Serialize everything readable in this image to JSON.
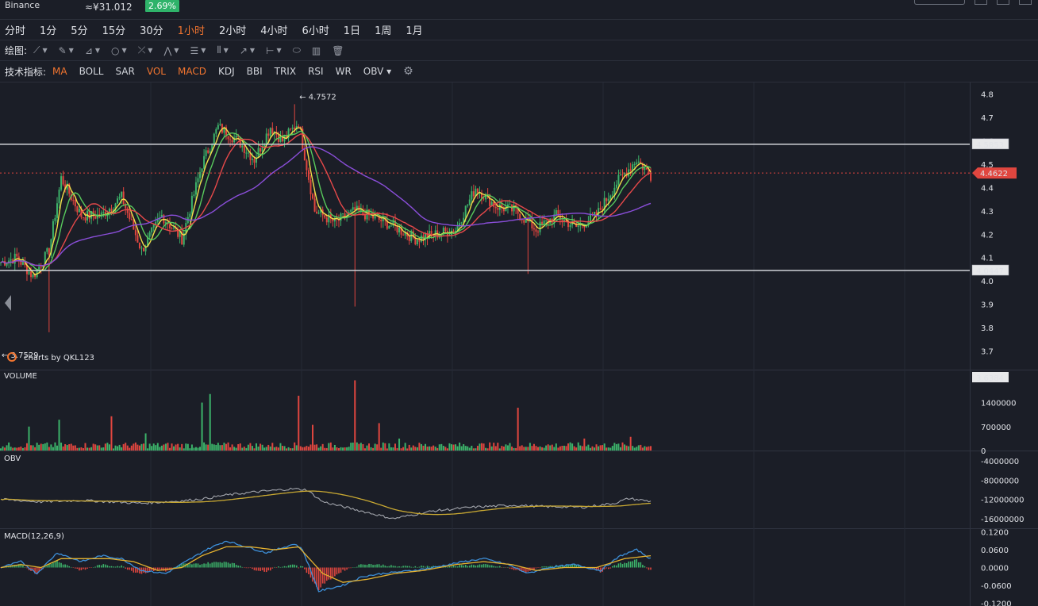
{
  "header": {
    "exchange": "Binance",
    "cny_price": "≈¥31.012",
    "change_pct": "2.69%"
  },
  "intervals": [
    "分时",
    "1分",
    "5分",
    "15分",
    "30分",
    "1小时",
    "2小时",
    "4小时",
    "6小时",
    "1日",
    "1周",
    "1月"
  ],
  "active_interval": "1小时",
  "drawing": {
    "label": "绘图:",
    "tools": [
      "trend-line-icon",
      "pen-icon",
      "channel-icon",
      "circle-icon",
      "cross-icon",
      "pattern-icon",
      "fib-icon",
      "grid-icon",
      "arrow-icon",
      "range-icon",
      "eraser-icon",
      "chart-icon",
      "trash-icon"
    ]
  },
  "indicators": {
    "label": "技术指标:",
    "items": [
      "MA",
      "BOLL",
      "SAR",
      "VOL",
      "MACD",
      "KDJ",
      "BBI",
      "TRIX",
      "RSI",
      "WR",
      "OBV"
    ],
    "active": [
      "MA",
      "VOL",
      "MACD"
    ]
  },
  "colors": {
    "up": "#3cb36a",
    "down": "#e0463f",
    "ma5": "#f2e04a",
    "ma10": "#58c95c",
    "ma20": "#e8494a",
    "ma60": "#8a4ed9",
    "obv": "#a3a6ad",
    "obv_ma": "#c8a832",
    "macd_dif": "#3d8fd8",
    "macd_dea": "#e5b22f",
    "current_price_bg": "#e0463f"
  },
  "chart_data": {
    "type": "candlestick",
    "watermark": "charts by QKL123",
    "price_panel": {
      "ylim": [
        3.62,
        4.85
      ],
      "ticks": [
        "4.8",
        "4.7",
        "4.6",
        "4.5",
        "4.4",
        "4.3",
        "4.2",
        "4.1",
        "4.0",
        "3.9",
        "3.8",
        "3.7"
      ],
      "high_label": "4.7572",
      "low_label": "3.7529",
      "high": 4.7572,
      "low": 3.7529,
      "resistance_line": "4.5853",
      "support_line": "4.0447",
      "resistance": 4.5853,
      "support": 4.0447,
      "current_price_label": "4.4622",
      "current_price": 4.4622,
      "axis_marker_label": "3.6384",
      "axis_marker": 3.6384,
      "ma_series": [
        "ma5",
        "ma10",
        "ma20",
        "ma60"
      ],
      "ohlc_keypoints": [
        [
          0,
          4.08
        ],
        [
          8,
          4.1
        ],
        [
          16,
          4.02
        ],
        [
          24,
          4.13
        ],
        [
          30,
          4.44
        ],
        [
          40,
          4.28
        ],
        [
          50,
          4.28
        ],
        [
          60,
          4.36
        ],
        [
          70,
          4.13
        ],
        [
          80,
          4.28
        ],
        [
          90,
          4.18
        ],
        [
          100,
          4.5
        ],
        [
          108,
          4.66
        ],
        [
          118,
          4.6
        ],
        [
          126,
          4.52
        ],
        [
          134,
          4.66
        ],
        [
          140,
          4.6
        ],
        [
          148,
          4.68
        ],
        [
          156,
          4.3
        ],
        [
          166,
          4.25
        ],
        [
          176,
          4.3
        ],
        [
          186,
          4.27
        ],
        [
          196,
          4.23
        ],
        [
          206,
          4.18
        ],
        [
          216,
          4.2
        ],
        [
          226,
          4.22
        ],
        [
          236,
          4.4
        ],
        [
          246,
          4.32
        ],
        [
          256,
          4.3
        ],
        [
          266,
          4.22
        ],
        [
          276,
          4.28
        ],
        [
          286,
          4.23
        ],
        [
          296,
          4.28
        ],
        [
          306,
          4.42
        ],
        [
          316,
          4.52
        ],
        [
          323,
          4.45
        ]
      ]
    },
    "volume_panel": {
      "label": "VOLUME",
      "ticks": [
        "1400000",
        "700000",
        "0"
      ],
      "ticks_values": [
        1400000,
        700000,
        0
      ],
      "ylim": [
        0,
        2200000
      ],
      "spikes": [
        [
          14,
          700000
        ],
        [
          29,
          900000
        ],
        [
          55,
          1000000
        ],
        [
          72,
          500000
        ],
        [
          100,
          1400000
        ],
        [
          104,
          1650000
        ],
        [
          148,
          1600000
        ],
        [
          155,
          750000
        ],
        [
          176,
          2050000
        ],
        [
          188,
          800000
        ],
        [
          198,
          350000
        ],
        [
          257,
          1250000
        ],
        [
          290,
          350000
        ],
        [
          313,
          400000
        ]
      ]
    },
    "obv_panel": {
      "label": "OBV",
      "ticks": [
        "-4000000",
        "-8000000",
        "-12000000",
        "-16000000"
      ],
      "ticks_values": [
        -4000000,
        -8000000,
        -12000000,
        -16000000
      ],
      "ylim": [
        -18000000,
        -2000000
      ],
      "keypoints": [
        [
          0,
          -12000000
        ],
        [
          20,
          -12500000
        ],
        [
          40,
          -12200000
        ],
        [
          70,
          -12800000
        ],
        [
          90,
          -12300000
        ],
        [
          102,
          -11800000
        ],
        [
          110,
          -11200000
        ],
        [
          125,
          -10500000
        ],
        [
          145,
          -9800000
        ],
        [
          152,
          -10000000
        ],
        [
          160,
          -12500000
        ],
        [
          180,
          -14500000
        ],
        [
          195,
          -16000000
        ],
        [
          215,
          -14400000
        ],
        [
          235,
          -13600000
        ],
        [
          255,
          -13200000
        ],
        [
          270,
          -13500000
        ],
        [
          290,
          -13600000
        ],
        [
          305,
          -12800000
        ],
        [
          312,
          -11800000
        ],
        [
          323,
          -12400000
        ]
      ]
    },
    "macd_panel": {
      "label": "MACD(12,26,9)",
      "ticks": [
        "0.1200",
        "0.0600",
        "0.0000",
        "-0.0600",
        "-0.1200"
      ],
      "ticks_values": [
        0.12,
        0.06,
        0.0,
        -0.06,
        -0.12
      ],
      "ylim": [
        -0.13,
        0.13
      ],
      "dif_keypoints": [
        [
          0,
          0.0
        ],
        [
          10,
          0.02
        ],
        [
          18,
          -0.02
        ],
        [
          28,
          0.05
        ],
        [
          40,
          0.02
        ],
        [
          50,
          0.04
        ],
        [
          60,
          0.03
        ],
        [
          70,
          -0.01
        ],
        [
          82,
          -0.02
        ],
        [
          92,
          0.02
        ],
        [
          102,
          0.06
        ],
        [
          112,
          0.09
        ],
        [
          122,
          0.07
        ],
        [
          132,
          0.05
        ],
        [
          146,
          0.08
        ],
        [
          150,
          0.06
        ],
        [
          158,
          -0.08
        ],
        [
          170,
          -0.06
        ],
        [
          180,
          -0.03
        ],
        [
          190,
          -0.02
        ],
        [
          205,
          -0.01
        ],
        [
          215,
          0.0
        ],
        [
          230,
          0.02
        ],
        [
          240,
          0.03
        ],
        [
          252,
          0.01
        ],
        [
          262,
          -0.02
        ],
        [
          272,
          0.0
        ],
        [
          285,
          0.01
        ],
        [
          298,
          -0.01
        ],
        [
          308,
          0.04
        ],
        [
          316,
          0.06
        ],
        [
          323,
          0.03
        ]
      ],
      "dea_keypoints": [
        [
          0,
          0.0
        ],
        [
          10,
          0.01
        ],
        [
          20,
          0.0
        ],
        [
          30,
          0.03
        ],
        [
          42,
          0.03
        ],
        [
          54,
          0.03
        ],
        [
          66,
          0.02
        ],
        [
          78,
          -0.01
        ],
        [
          90,
          0.0
        ],
        [
          100,
          0.04
        ],
        [
          112,
          0.07
        ],
        [
          124,
          0.07
        ],
        [
          136,
          0.06
        ],
        [
          148,
          0.07
        ],
        [
          160,
          -0.02
        ],
        [
          170,
          -0.05
        ],
        [
          182,
          -0.04
        ],
        [
          196,
          -0.02
        ],
        [
          210,
          -0.01
        ],
        [
          226,
          0.01
        ],
        [
          240,
          0.02
        ],
        [
          254,
          0.01
        ],
        [
          266,
          -0.01
        ],
        [
          280,
          0.0
        ],
        [
          296,
          0.0
        ],
        [
          310,
          0.03
        ],
        [
          323,
          0.04
        ]
      ]
    }
  }
}
